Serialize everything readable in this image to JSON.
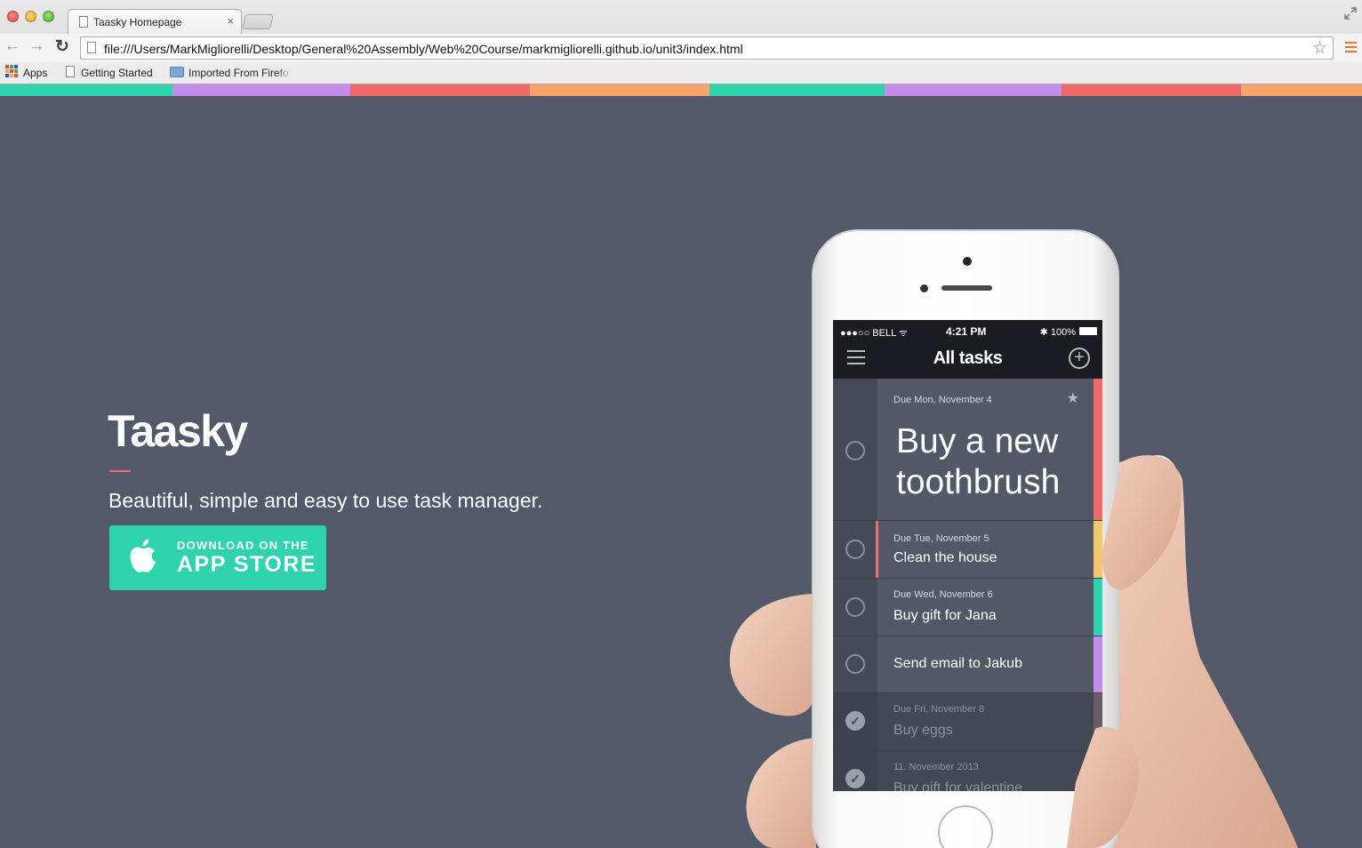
{
  "browser": {
    "tab_title": "Taasky Homepage",
    "tab_close": "×",
    "url": "file:///Users/MarkMigliorelli/Desktop/General%20Assembly/Web%20Course/markmigliorelli.github.io/unit3/index.html",
    "back_glyph": "←",
    "forward_glyph": "→",
    "reload_glyph": "↻",
    "star_glyph": "☆",
    "bookmarks": {
      "apps": "Apps",
      "getting_started": "Getting Started",
      "imported": "Imported From Firefox"
    }
  },
  "stripe_colors": [
    "#2ed2ad",
    "#c48cea",
    "#f06a6a",
    "#f9a46b",
    "#2ed2ad",
    "#c48cea",
    "#f06a6a",
    "#f9a46b"
  ],
  "hero": {
    "title": "Taasky",
    "tagline": "Beautiful, simple and easy to use task manager.",
    "store_small": "DOWNLOAD ON THE",
    "store_big": "APP STORE",
    "accent": "#2ed2ad"
  },
  "phone": {
    "carrier": "●●●○○ BELL ᯤ",
    "time": "4:21 PM",
    "battery": "✱ 100%",
    "nav_title": "All tasks",
    "add_glyph": "+",
    "tasks": [
      {
        "due": "Due Mon, November 4",
        "name_line1": "Buy a new",
        "name_line2": "toothbrush",
        "color": "#f06a6a",
        "done": false,
        "starred": true
      },
      {
        "due": "Due Tue, November 5",
        "name": "Clean the house",
        "color": "#f2c66d",
        "done": false
      },
      {
        "due": "Due Wed, November 6",
        "name": "Buy gift for Jana",
        "color": "#2ed2ad",
        "done": false
      },
      {
        "due": "",
        "name": "Send email to Jakub",
        "color": "#c48cea",
        "done": false
      },
      {
        "due": "Due Fri, November 8",
        "name": "Buy eggs",
        "color": "#6b5c6a",
        "done": true
      },
      {
        "due": "11. November 2013",
        "name": "Buy gift for valentine",
        "color": "#3b8f7e",
        "done": true
      }
    ],
    "star_glyph": "★",
    "check_glyph": "✓"
  }
}
